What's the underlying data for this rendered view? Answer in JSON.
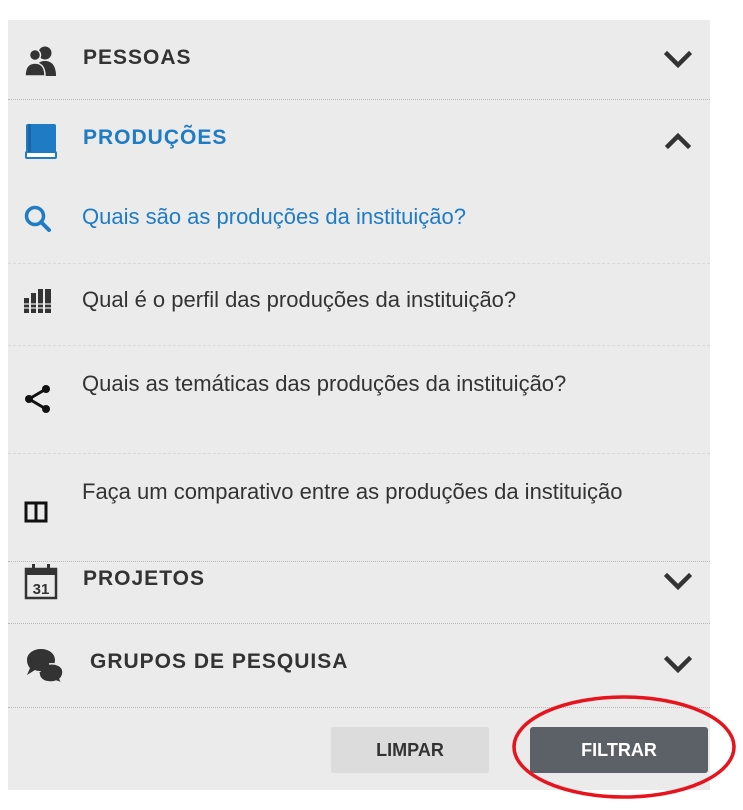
{
  "sections": [
    {
      "label": "PESSOAS",
      "icon": "people-icon",
      "expanded": false
    },
    {
      "label": "PRODUÇÕES",
      "icon": "book-icon",
      "expanded": true
    },
    {
      "label": "PROJETOS",
      "icon": "calendar-icon",
      "expanded": false
    },
    {
      "label": "GRUPOS DE PESQUISA",
      "icon": "chat-bubbles-icon",
      "expanded": false
    }
  ],
  "producoes_items": [
    {
      "text": "Quais são as produções da instituição?",
      "icon": "search-icon",
      "active": true
    },
    {
      "text": "Qual é o perfil das produções da instituição?",
      "icon": "bar-chart-icon",
      "active": false
    },
    {
      "text": "Quais as temáticas das produções da instituição?",
      "icon": "share-icon",
      "active": false
    },
    {
      "text": "Faça um comparativo entre as produções da instituição",
      "icon": "compare-columns-icon",
      "active": false
    }
  ],
  "buttons": {
    "clear_label": "LIMPAR",
    "filter_label": "FILTRAR"
  },
  "colors": {
    "panel_bg": "#ebebeb",
    "accent_blue": "#1e7bc4",
    "text_dark": "#333333",
    "filter_button_bg": "#5c6168",
    "clear_button_bg": "#dcdcdc",
    "annotation_red": "#e8141d"
  }
}
